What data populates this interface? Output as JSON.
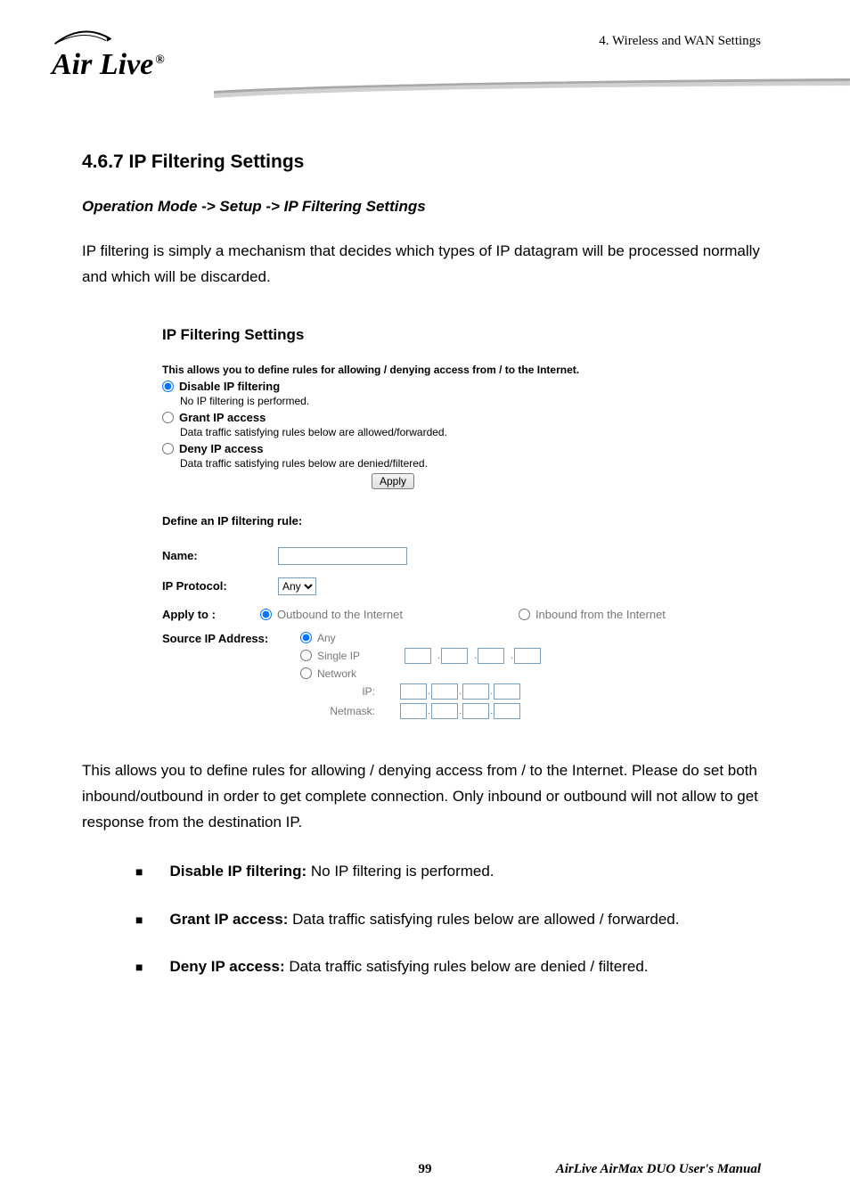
{
  "header": {
    "breadcrumb_section": "4. Wireless and WAN Settings",
    "logo_brand": "Air Live"
  },
  "section": {
    "number_title": "4.6.7 IP Filtering Settings",
    "operation_path": "Operation Mode -> Setup -> IP Filtering Settings",
    "intro": "IP filtering is simply a mechanism that decides which types of IP datagram will be processed normally and which will be discarded."
  },
  "screenshot": {
    "title": "IP Filtering Settings",
    "intro": "This allows you to define rules for allowing / denying access from / to the Internet.",
    "mode_options": {
      "disable": {
        "label": "Disable IP filtering",
        "desc": "No IP filtering is performed."
      },
      "grant": {
        "label": "Grant IP access",
        "desc": "Data traffic satisfying rules below are allowed/forwarded."
      },
      "deny": {
        "label": "Deny IP access",
        "desc": "Data traffic satisfying rules below are denied/filtered."
      }
    },
    "apply_label": "Apply",
    "define_heading": "Define an IP filtering rule:",
    "fields": {
      "name_label": "Name:",
      "protocol_label": "IP Protocol:",
      "protocol_value": "Any",
      "applyto_label": "Apply to :",
      "outbound_label": "Outbound to the Internet",
      "inbound_label": "Inbound from the Internet",
      "src_label": "Source IP Address:",
      "src_any": "Any",
      "src_single": "Single IP",
      "src_network": "Network",
      "src_ip_label": "IP:",
      "src_netmask_label": "Netmask:"
    }
  },
  "explain": {
    "para": "This allows you to define rules for allowing / denying access from / to the Internet. Please do set both inbound/outbound in order to get complete connection. Only inbound or outbound will not allow to get response from the destination IP.",
    "bullets": [
      {
        "bold": "Disable IP filtering:",
        "rest": " No IP filtering is performed."
      },
      {
        "bold": "Grant IP access:",
        "rest": " Data traffic satisfying rules below are allowed / forwarded."
      },
      {
        "bold": "Deny IP access:",
        "rest": " Data traffic satisfying rules below are denied / filtered."
      }
    ]
  },
  "footer": {
    "page": "99",
    "manual": "AirLive AirMax DUO User's Manual"
  }
}
